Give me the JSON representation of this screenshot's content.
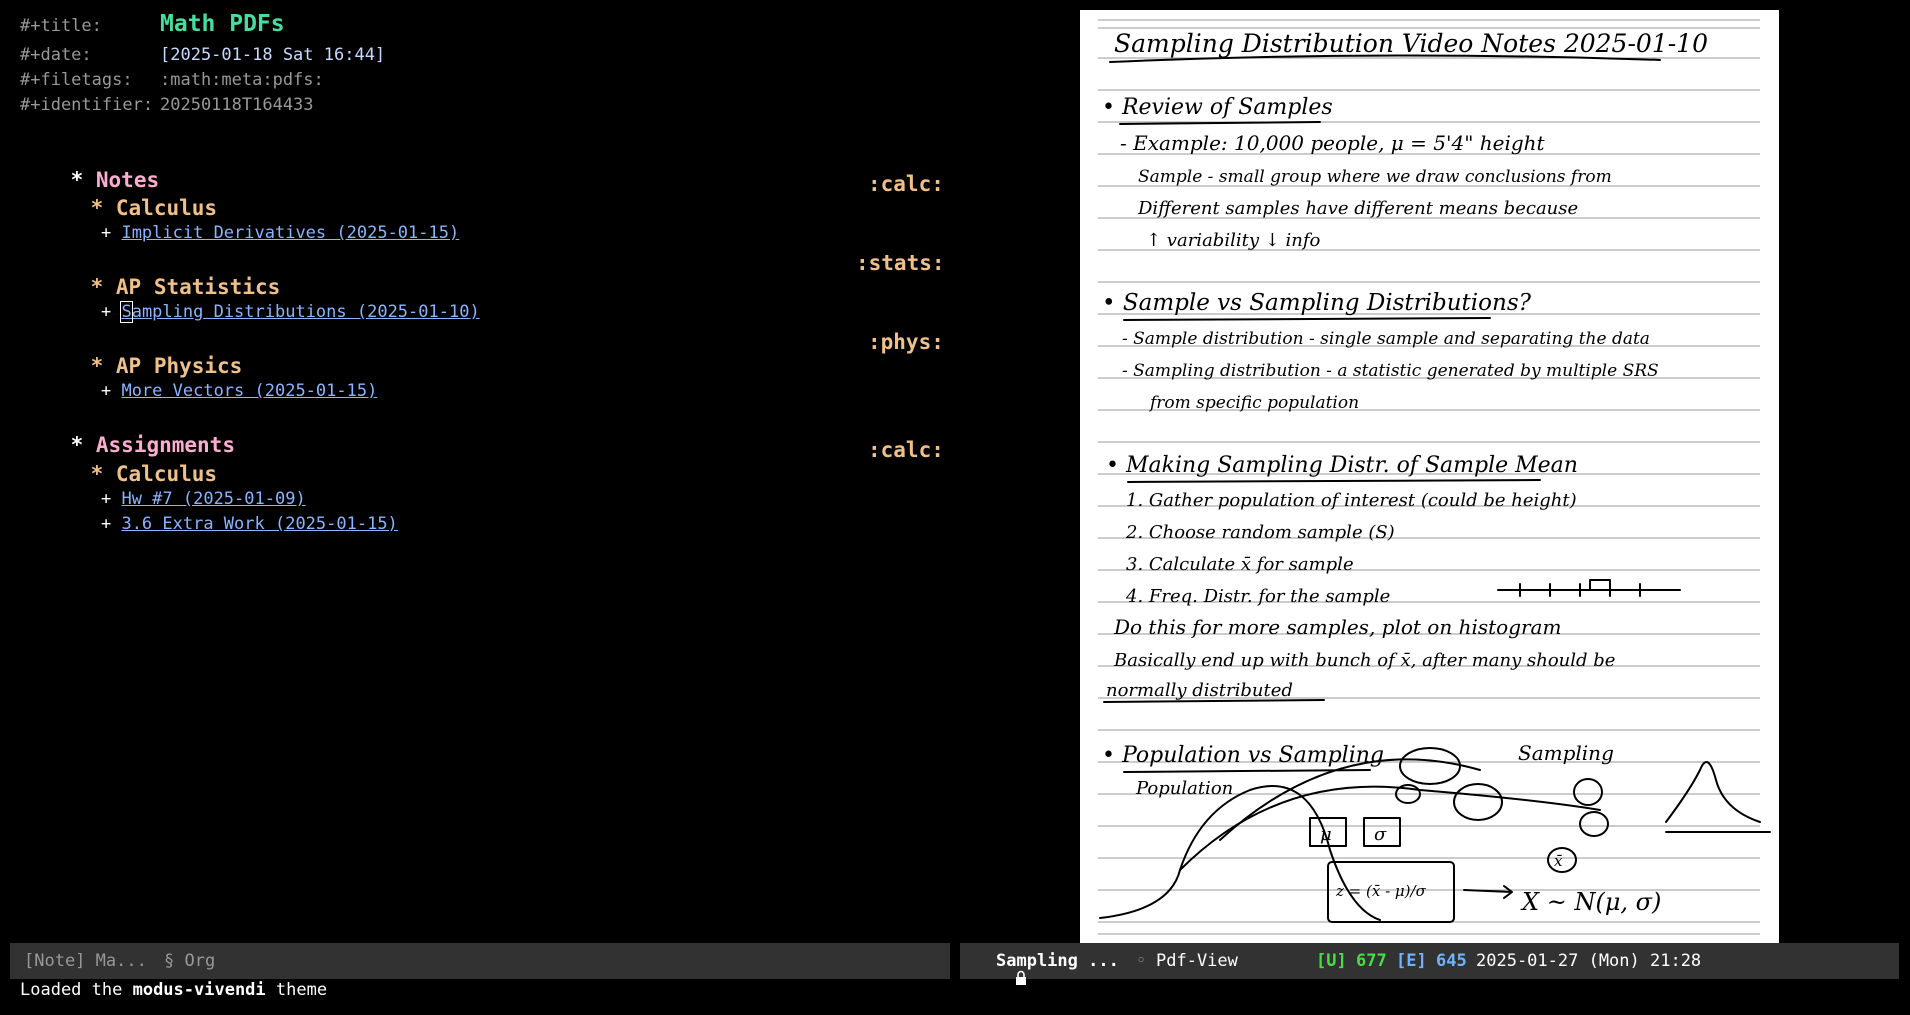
{
  "org": {
    "meta": {
      "title_key": "#+title:",
      "title_value": "Math PDFs",
      "date_key": "#+date:",
      "date_value": "[2025-01-18 Sat 16:44]",
      "filetags_key": "#+filetags:",
      "filetags_value": ":math:meta:pdfs:",
      "identifier_key": "#+identifier:",
      "identifier_value": "20250118T164433"
    },
    "star": "*",
    "plus": "+",
    "notes": {
      "label": "Notes",
      "calculus": {
        "label": "Calculus",
        "tag": ":calc:",
        "links": [
          "Implicit Derivatives (2025-01-15)"
        ]
      },
      "stats": {
        "label": "AP Statistics",
        "tag": ":stats:",
        "link_first_char": "S",
        "link_rest": "ampling Distributions (2025-01-10)"
      },
      "physics": {
        "label": "AP Physics",
        "tag": ":phys:",
        "links": [
          "More Vectors (2025-01-15)"
        ]
      }
    },
    "assignments": {
      "label": "Assignments",
      "calculus": {
        "label": "Calculus",
        "tag": ":calc:",
        "links": [
          "Hw #7 (2025-01-09)",
          "3.6 Extra Work (2025-01-15)"
        ]
      }
    }
  },
  "pdf": {
    "title": "Sampling Distribution Video Notes 2025-01-10",
    "lines": [
      "• Review of Samples",
      "- Example: 10,000 people, μ = 5'4\" height",
      "Sample - small group where we draw conclusions from",
      "Different samples have different means because",
      "↑ variability ↓ info",
      "• Sample vs Sampling Distributions?",
      "- Sample distribution - single sample and separating the data",
      "- Sampling distribution - a statistic generated by multiple SRS",
      "from specific population",
      "• Making Sampling Distr. of Sample Mean",
      "1. Gather population of interest (could be height)",
      "2. Choose random sample (S)",
      "3. Calculate x̄ for sample",
      "4. Freq. Distr. for the sample",
      "Do this for more samples, plot on histogram",
      "Basically end up with bunch of x̄, after many should be",
      "normally distributed",
      "• Population vs Sampling",
      "Sampling",
      "Population",
      "μ",
      "σ",
      "x̄",
      "z = (x̄ - μ)/σ",
      "X ~ N(μ, σ)"
    ]
  },
  "modeline_left": {
    "mode": "[Note] Ma...",
    "major": "§ Org"
  },
  "modeline_right": {
    "lock_icon": "lock-icon",
    "buffer": "Sampling ...",
    "dot": "◦",
    "mode": "Pdf-View",
    "u_label": "[U]",
    "u_value": "677",
    "e_label": "[E]",
    "e_value": "645",
    "datetime": "2025-01-27 (Mon) 21:28",
    "colors": {
      "green": "#44df44",
      "blue": "#6fb4ff"
    }
  },
  "echo": {
    "prefix": "Loaded the ",
    "theme": "modus-vivendi",
    "suffix": " theme"
  }
}
